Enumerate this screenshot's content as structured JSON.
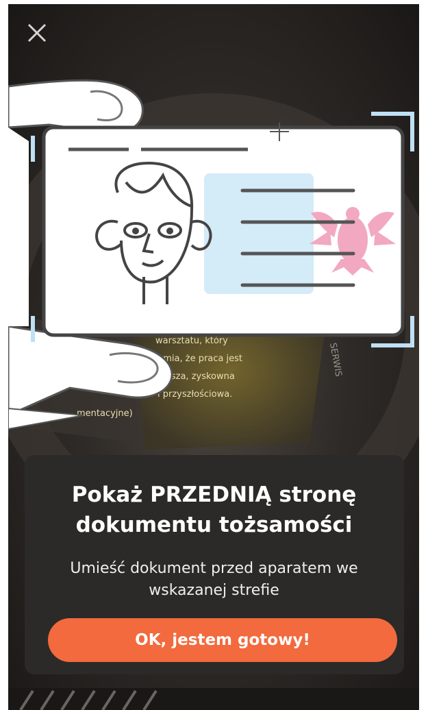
{
  "instruction": {
    "title_line1": "Pokaż PRZEDNIĄ stronę",
    "title_line2": "dokumentu tożsamości",
    "subtitle_line1": "Umieść dokument przed aparatem we",
    "subtitle_line2": "wskazanej strefie"
  },
  "buttons": {
    "ok_label": "OK, jestem gotowy!"
  },
  "background_text": {
    "poster_line1": "warsztatu, który",
    "poster_line2": "umia, że praca jest",
    "poster_line3": "lepsza, zyskowna",
    "poster_line4": "i przyszłościowa.",
    "poster_side": "SERWIS",
    "poster_left": "mentacyjne)"
  },
  "icons": {
    "close": "close-icon",
    "crosshair": "crosshair-icon",
    "id_card": "id-card-illustration",
    "eagle": "eagle-emblem"
  },
  "colors": {
    "accent": "#f26a3d",
    "panel": "#2b2a28",
    "corner_guides": "#bfe0f5",
    "photo_area": "#d4ebf8",
    "eagle": "#f2a8c0"
  }
}
